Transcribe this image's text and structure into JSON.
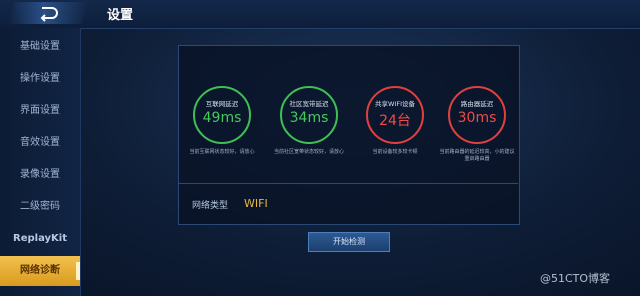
{
  "header": {
    "title": "设置"
  },
  "sidebar": {
    "items": [
      {
        "label": "基础设置"
      },
      {
        "label": "操作设置"
      },
      {
        "label": "界面设置"
      },
      {
        "label": "音效设置"
      },
      {
        "label": "录像设置"
      },
      {
        "label": "二级密码"
      },
      {
        "label": "ReplayKit"
      },
      {
        "label": "网络诊断"
      }
    ],
    "active_index": 7
  },
  "stats": [
    {
      "label": "互联网延迟",
      "value": "49ms",
      "desc": "当前互联网状态较好，请放心",
      "status": "good"
    },
    {
      "label": "社区宽带延迟",
      "value": "34ms",
      "desc": "当前社区宽带状态较好，请放心",
      "status": "good"
    },
    {
      "label": "共享WIFI设备",
      "value": "24台",
      "desc": "当前设备较多较卡顿",
      "status": "bad"
    },
    {
      "label": "路由器延迟",
      "value": "30ms",
      "desc": "当前路由器的延迟较高，小的建议重启路由器",
      "status": "bad"
    }
  ],
  "network": {
    "label": "网络类型",
    "value": "WIFI"
  },
  "actions": {
    "start": "开始检测"
  },
  "watermark": "@51CTO博客",
  "colors": {
    "good": "#46c85a",
    "bad": "#ef4b48",
    "accent": "#e5b844",
    "active_tab": "#f2c14e"
  }
}
